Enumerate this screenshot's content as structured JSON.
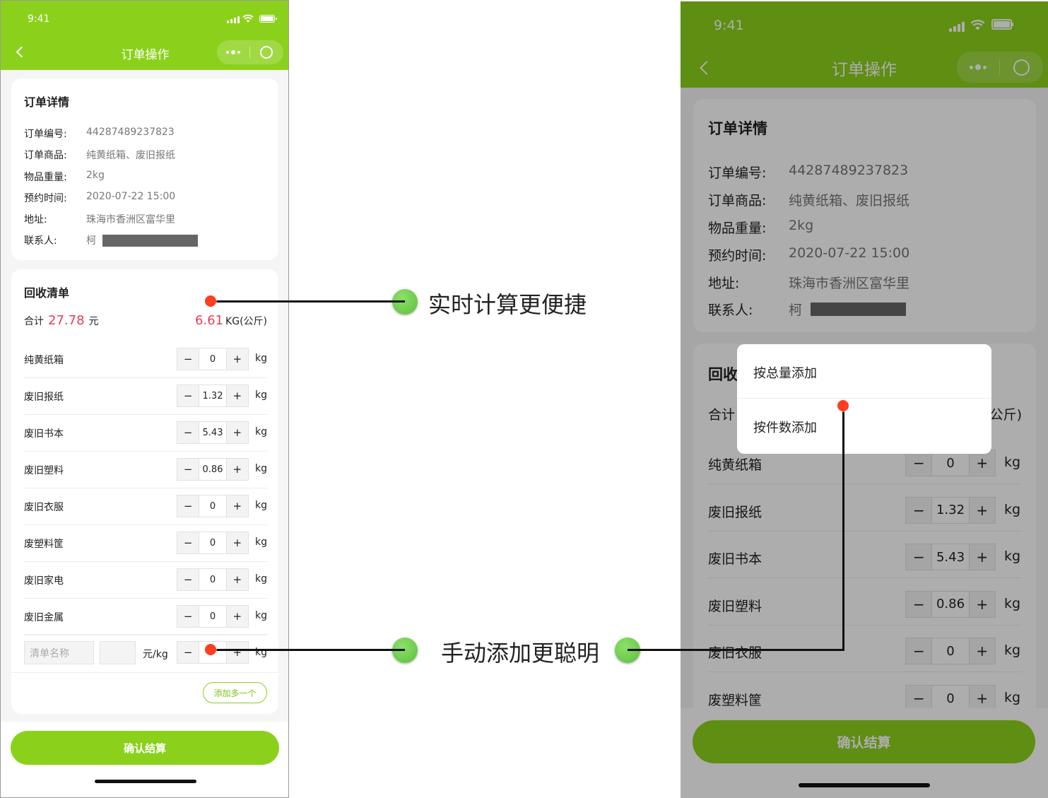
{
  "status": {
    "time": "9:41"
  },
  "nav": {
    "title": "订单操作"
  },
  "order": {
    "heading": "订单详情",
    "rows": [
      {
        "k": "订单编号:",
        "v": "44287489237823"
      },
      {
        "k": "订单商品:",
        "v": "纯黄纸箱、废旧报纸"
      },
      {
        "k": "物品重量:",
        "v": "2kg"
      },
      {
        "k": "预约时间:",
        "v": "2020-07-22 15:00"
      },
      {
        "k": "地址:",
        "v": "珠海市香洲区富华里"
      },
      {
        "k": "联系人:",
        "v": "柯"
      }
    ]
  },
  "recycle": {
    "heading": "回收清单",
    "total_label": "合计",
    "total_amount": "27.78",
    "total_unit": "元",
    "weight": "6.61",
    "weight_unit": "KG(公斤)",
    "items": [
      {
        "name": "纯黄纸箱",
        "qty": "0",
        "unit": "kg"
      },
      {
        "name": "废旧报纸",
        "qty": "1.32",
        "unit": "kg"
      },
      {
        "name": "废旧书本",
        "qty": "5.43",
        "unit": "kg"
      },
      {
        "name": "废旧塑料",
        "qty": "0.86",
        "unit": "kg"
      },
      {
        "name": "废旧衣服",
        "qty": "0",
        "unit": "kg"
      },
      {
        "name": "废塑料筐",
        "qty": "0",
        "unit": "kg"
      },
      {
        "name": "废旧家电",
        "qty": "0",
        "unit": "kg"
      },
      {
        "name": "废旧金属",
        "qty": "0",
        "unit": "kg"
      }
    ],
    "custom": {
      "name_placeholder": "清单名称",
      "price_unit": "元/kg",
      "unit": "kg"
    },
    "add_more": "添加多一个",
    "minus": "−",
    "plus": "+"
  },
  "confirm_label": "确认结算",
  "popup": {
    "option1": "按总量添加",
    "option2": "按件数添加"
  },
  "phone2": {
    "total_label_partial": "合计",
    "recycle_partial": "回收",
    "weight_partial": "公斤)"
  },
  "annotations": {
    "a1": "实时计算更便捷",
    "a2": "手动添加更聪明"
  }
}
